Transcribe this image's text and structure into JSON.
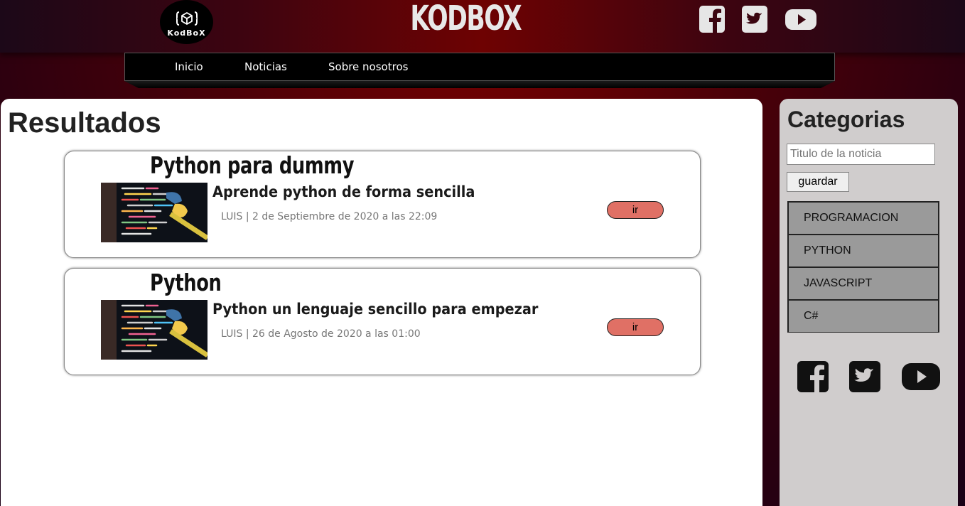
{
  "header": {
    "logo_text": "KodBoX",
    "brand": "KODBOX",
    "social": [
      "facebook-icon",
      "twitter-icon",
      "youtube-icon"
    ]
  },
  "nav": {
    "items": [
      {
        "label": "Inicio"
      },
      {
        "label": "Noticias"
      },
      {
        "label": "Sobre nosotros"
      }
    ]
  },
  "main": {
    "title": "Resultados",
    "results": [
      {
        "title": "Python para dummy",
        "subtitle": "Aprende python de forma sencilla",
        "meta": "LUIS | 2 de Septiembre de 2020 a las 22:09",
        "button": "ir"
      },
      {
        "title": "Python",
        "subtitle": "Python un lenguaje sencillo para empezar",
        "meta": "LUIS | 26 de Agosto de 2020 a las 01:00",
        "button": "ir"
      }
    ]
  },
  "sidebar": {
    "title": "Categorias",
    "input_placeholder": "Titulo de la noticia",
    "save_label": "guardar",
    "categories": [
      {
        "label": "PROGRAMACION"
      },
      {
        "label": "PYTHON"
      },
      {
        "label": "JAVASCRIPT"
      },
      {
        "label": "C#"
      }
    ],
    "social": [
      "facebook-icon",
      "twitter-icon",
      "youtube-icon"
    ]
  },
  "colors": {
    "accent_button": "#e07065",
    "header_red": "#6e0202",
    "sidebar_bg": "#d0cdcd",
    "category_bg": "#9a9a9a"
  }
}
